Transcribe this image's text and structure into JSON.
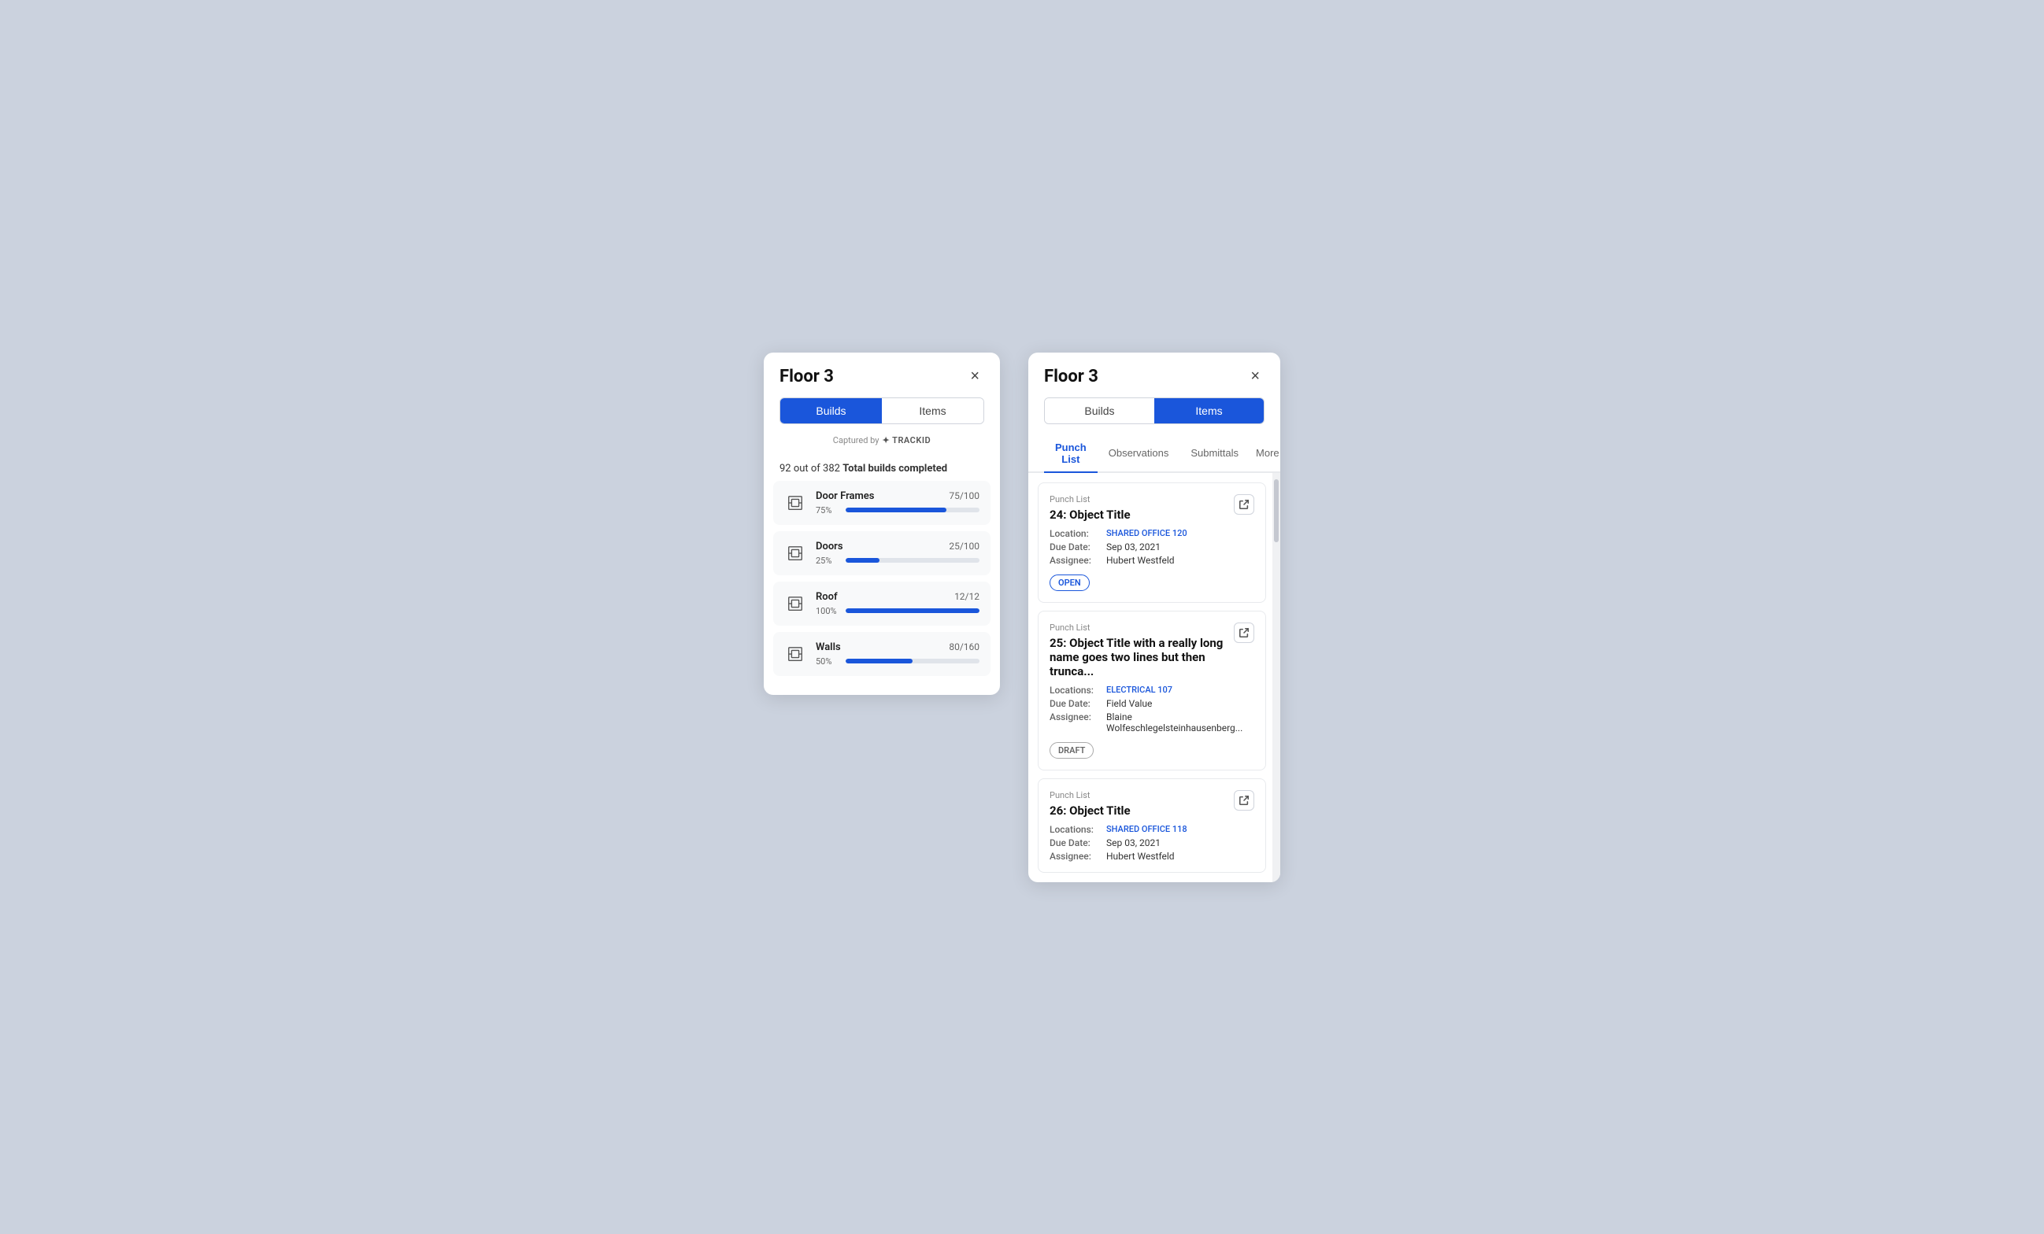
{
  "app": {
    "background": "#cbd2de"
  },
  "left_panel": {
    "title": "Floor 3",
    "close_label": "×",
    "tabs": [
      {
        "label": "Builds",
        "active": true
      },
      {
        "label": "Items",
        "active": false
      }
    ],
    "captured_by": "Captured by",
    "trackid_logo": "✦ TRACKID",
    "builds_summary": "92 out of 382 Total builds completed",
    "builds": [
      {
        "name": "Door Frames",
        "count": "75/100",
        "pct": "75%",
        "fill_pct": 75
      },
      {
        "name": "Doors",
        "count": "25/100",
        "pct": "25%",
        "fill_pct": 25
      },
      {
        "name": "Roof",
        "count": "12/12",
        "pct": "100%",
        "fill_pct": 100
      },
      {
        "name": "Walls",
        "count": "80/160",
        "pct": "50%",
        "fill_pct": 50
      }
    ]
  },
  "right_panel": {
    "title": "Floor 3",
    "close_label": "×",
    "tabs": [
      {
        "label": "Builds",
        "active": false
      },
      {
        "label": "Items",
        "active": true
      }
    ],
    "subnav": [
      {
        "label": "Punch List",
        "active": true
      },
      {
        "label": "Observations",
        "active": false
      },
      {
        "label": "Submittals",
        "active": false
      },
      {
        "label": "More",
        "active": false,
        "has_dropdown": true
      }
    ],
    "items": [
      {
        "type": "Punch List",
        "title": "24: Object Title",
        "fields": [
          {
            "label": "Location:",
            "value": "SHARED OFFICE 120",
            "is_link": true
          },
          {
            "label": "Due Date:",
            "value": "Sep 03, 2021",
            "is_link": false
          },
          {
            "label": "Assignee:",
            "value": "Hubert Westfeld",
            "is_link": false
          }
        ],
        "status": "OPEN",
        "status_type": "open"
      },
      {
        "type": "Punch List",
        "title": "25: Object Title with a really long name goes two lines but then trunca...",
        "fields": [
          {
            "label": "Locations:",
            "value": "ELECTRICAL 107",
            "is_link": true
          },
          {
            "label": "Due Date:",
            "value": "Field Value",
            "is_link": false
          },
          {
            "label": "Assignee:",
            "value": "Blaine Wolfeschlegelsteinhausenberg...",
            "is_link": false
          }
        ],
        "status": "DRAFT",
        "status_type": "draft"
      },
      {
        "type": "Punch List",
        "title": "26: Object Title",
        "fields": [
          {
            "label": "Locations:",
            "value": "SHARED OFFICE 118",
            "is_link": true
          },
          {
            "label": "Due Date:",
            "value": "Sep 03, 2021",
            "is_link": false
          },
          {
            "label": "Assignee:",
            "value": "Hubert Westfeld",
            "is_link": false
          }
        ],
        "status": null,
        "status_type": null
      }
    ]
  }
}
